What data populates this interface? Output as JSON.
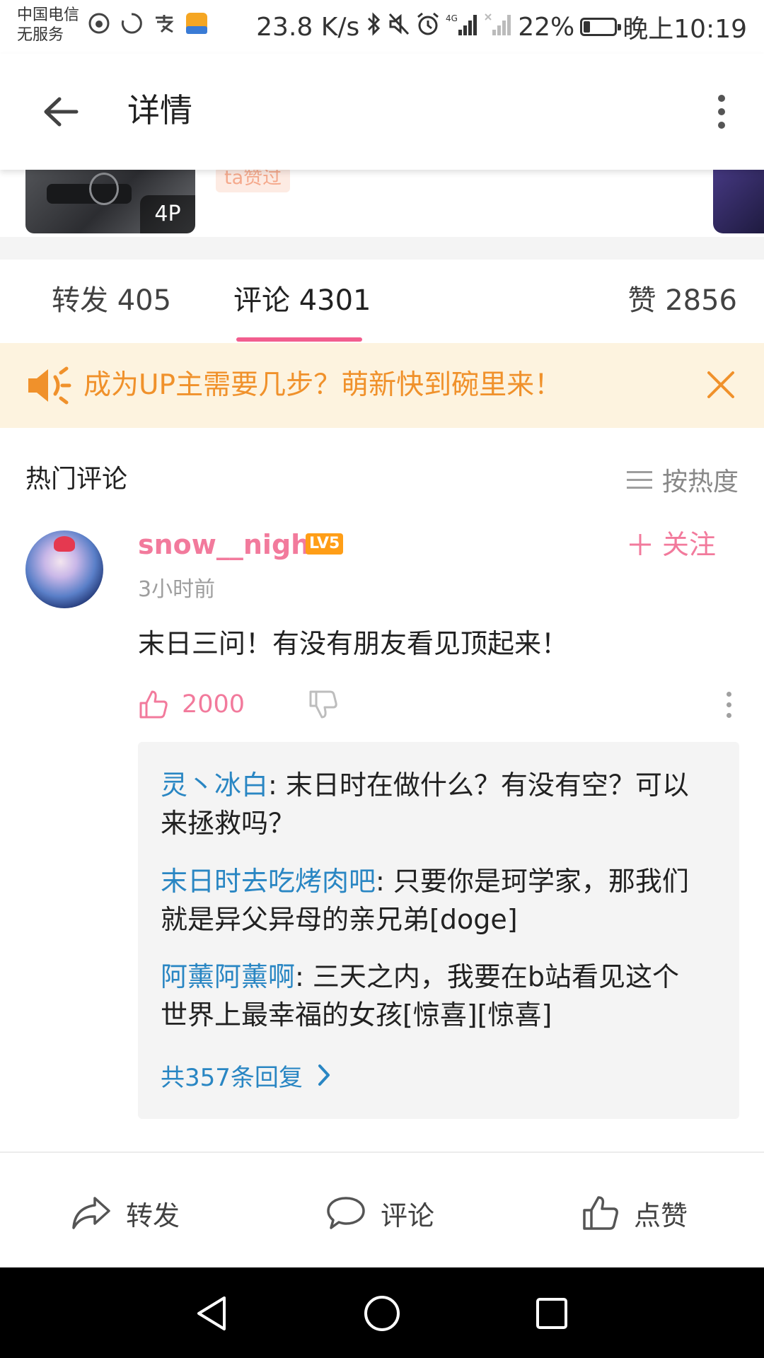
{
  "status_bar": {
    "carrier_line1": "中国电信",
    "carrier_line2": "无服务",
    "net_speed": "23.8 K/s",
    "battery": "22%",
    "battery_level": 0.22,
    "time": "晚上10:19"
  },
  "toolbar": {
    "back_icon": "arrow-left-icon",
    "title": "详情",
    "more_icon": "more-vert-icon"
  },
  "post_strip": {
    "page_count": "4P",
    "liked_badge": "ta赞过"
  },
  "tabs": [
    {
      "label": "转发 405"
    },
    {
      "label": "评论 4301"
    },
    {
      "label": "赞 2856"
    }
  ],
  "notice": {
    "icon": "speaker-icon",
    "text": "成为UP主需要几步？萌新快到碗里来！",
    "close_icon": "close-icon"
  },
  "hot_comments": {
    "title": "热门评论",
    "sort_label": "按热度"
  },
  "comment": {
    "username": "snow__night",
    "level": "LV5",
    "follow_label": "关注",
    "time": "3小时前",
    "text": "末日三问！有没有朋友看见顶起来！",
    "like_count": "2000",
    "replies": [
      {
        "name": "灵丶冰白",
        "text": ": 末日时在做什么？有没有空？可以来拯救吗？"
      },
      {
        "name": "末日时去吃烤肉吧",
        "text": ": 只要你是珂学家，那我们就是异父异母的亲兄弟[doge]"
      },
      {
        "name": "阿薰阿薰啊",
        "text": ": 三天之内，我要在b站看见这个世界上最幸福的女孩[惊喜][惊喜]"
      }
    ],
    "all_replies_label": "共357条回复"
  },
  "bottom_bar": {
    "share_label": "转发",
    "comment_label": "评论",
    "like_label": "点赞"
  },
  "colors": {
    "accent_pink": "#f25d8e",
    "link_blue": "#2986c3",
    "notice_orange": "#f0912b",
    "notice_bg": "#fdf3df"
  }
}
